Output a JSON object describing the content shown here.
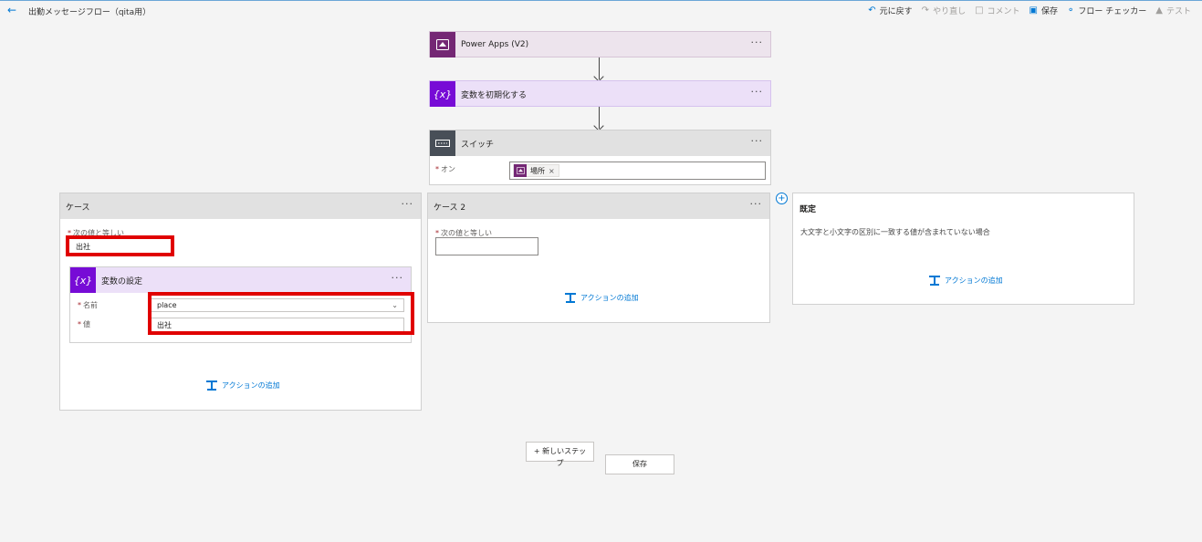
{
  "header": {
    "title": "出勤メッセージフロー（qita用）",
    "toolbar": {
      "undo": "元に戻す",
      "redo": "やり直し",
      "comment": "コメント",
      "save": "保存",
      "flow_checker": "フロー チェッカー",
      "test": "テスト"
    }
  },
  "steps": {
    "trigger": "Power Apps (V2)",
    "init_variable": "変数を初期化する",
    "switch": {
      "title": "スイッチ",
      "on_label": "オン",
      "token": "場所",
      "token_remove": "×"
    }
  },
  "cases": {
    "case1": {
      "title": "ケース",
      "equals_label": "次の値と等しい",
      "equals_value": "出社",
      "action": {
        "title": "変数の設定",
        "name_label": "名前",
        "name_value": "place",
        "value_label": "値",
        "value_value": "出社"
      },
      "add_action": "アクションの追加"
    },
    "case2": {
      "title": "ケース 2",
      "equals_label": "次の値と等しい",
      "equals_value": "",
      "add_action": "アクションの追加"
    },
    "default": {
      "title": "既定",
      "description": "大文字と小文字の区別に一致する値が含まれていない場合",
      "add_action": "アクションの追加"
    }
  },
  "footer": {
    "new_step": "+ 新しいステップ",
    "save": "保存"
  },
  "colors": {
    "accent": "#0078d4",
    "power_apps": "#742774",
    "variable": "#770bd6",
    "switch": "#484f58",
    "highlight": "#e00000"
  }
}
